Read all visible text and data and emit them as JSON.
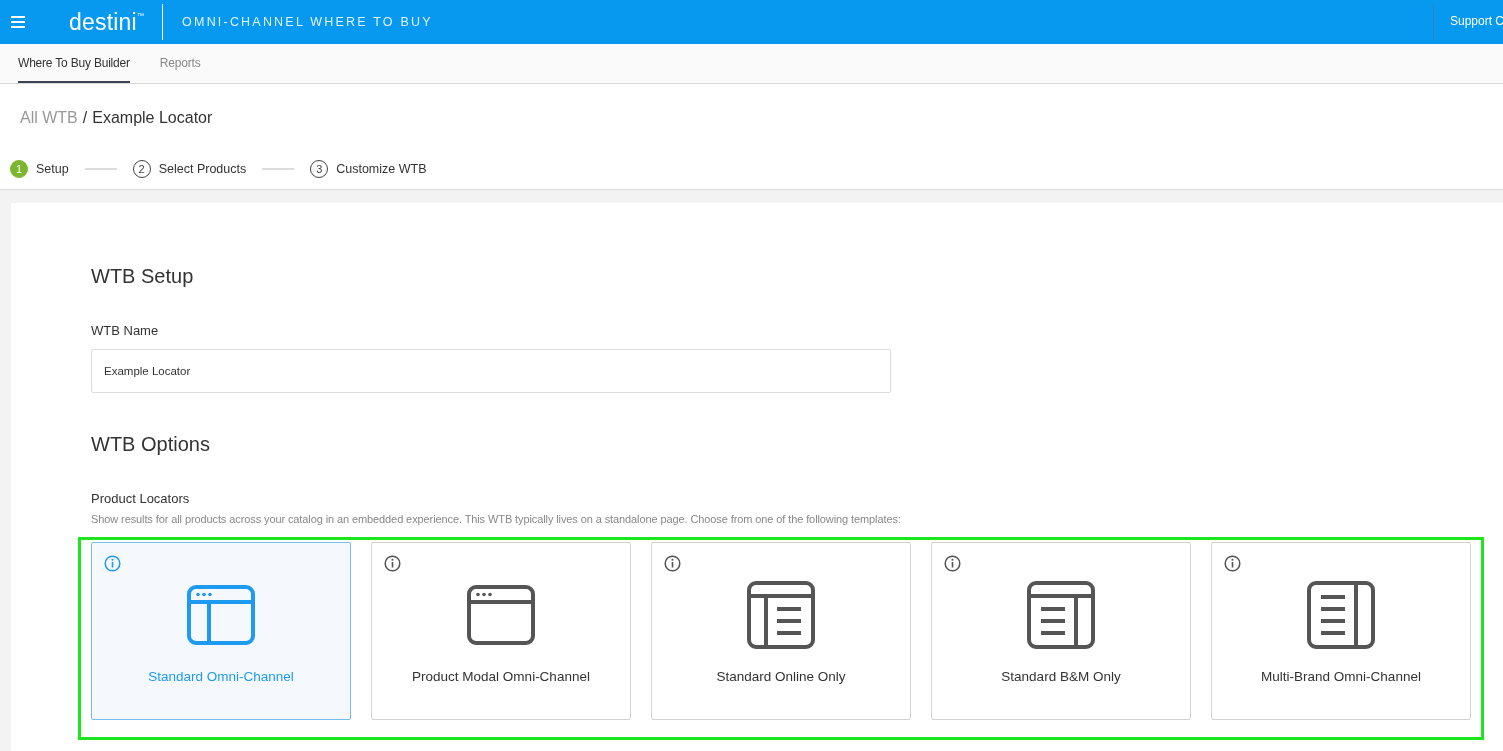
{
  "header": {
    "logo": "destini",
    "logo_mark": "™",
    "title": "OMNI-CHANNEL WHERE TO BUY",
    "support": "Support C"
  },
  "tabs": [
    {
      "label": "Where To Buy Builder",
      "selected": true
    },
    {
      "label": "Reports",
      "selected": false
    }
  ],
  "breadcrumb": {
    "parent": "All WTB",
    "separator": "/",
    "current": "Example Locator"
  },
  "steps": [
    {
      "number": "1",
      "label": "Setup",
      "selected": true
    },
    {
      "number": "2",
      "label": "Select Products",
      "selected": false
    },
    {
      "number": "3",
      "label": "Customize WTB",
      "selected": false
    }
  ],
  "setup": {
    "heading": "WTB Setup",
    "name_label": "WTB Name",
    "name_value": "Example Locator"
  },
  "options": {
    "heading": "WTB Options",
    "section": "Product Locators",
    "description": "Show results for all products across your catalog in an embedded experience. This WTB typically lives on a standalone page. Choose from one of the following templates:",
    "templates": [
      {
        "label": "Standard Omni-Channel",
        "kind": "split",
        "selected": true
      },
      {
        "label": "Product Modal Omni-Channel",
        "kind": "window",
        "selected": false
      },
      {
        "label": "Standard Online Only",
        "kind": "left-list",
        "selected": false
      },
      {
        "label": "Standard B&M Only",
        "kind": "right-list",
        "selected": false
      },
      {
        "label": "Multi-Brand Omni-Channel",
        "kind": "side-list",
        "selected": false
      }
    ]
  }
}
